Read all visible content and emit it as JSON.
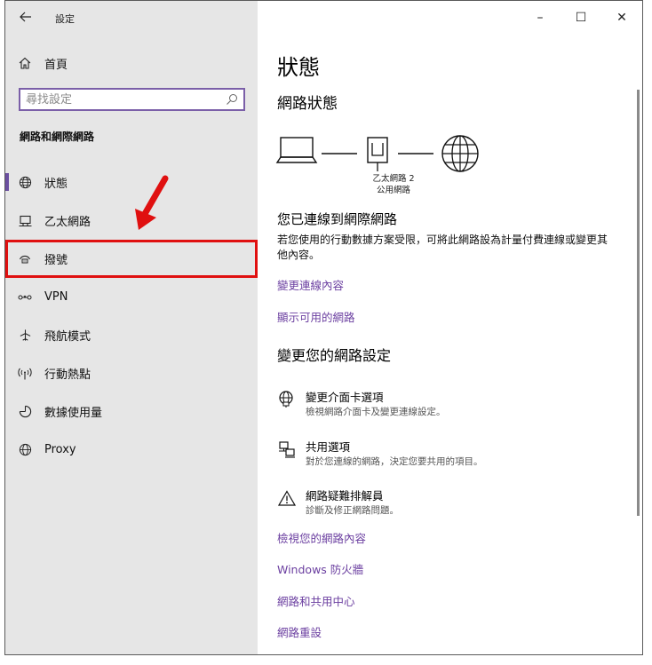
{
  "window": {
    "title": "設定",
    "minimize": "–",
    "maximize": "☐",
    "close": "✕"
  },
  "sidebar": {
    "home_label": "首頁",
    "search_placeholder": "尋找設定",
    "section_title": "網路和網際網路",
    "items": [
      {
        "label": "狀態",
        "icon": "globe-icon"
      },
      {
        "label": "乙太網路",
        "icon": "ethernet-icon"
      },
      {
        "label": "撥號",
        "icon": "dialup-icon"
      },
      {
        "label": "VPN",
        "icon": "vpn-icon"
      },
      {
        "label": "飛航模式",
        "icon": "airplane-icon"
      },
      {
        "label": "行動熱點",
        "icon": "hotspot-icon"
      },
      {
        "label": "數據使用量",
        "icon": "data-usage-icon"
      },
      {
        "label": "Proxy",
        "icon": "globe-icon"
      }
    ],
    "selected_index": 0,
    "highlighted_index": 2
  },
  "main": {
    "title": "狀態",
    "network_status_heading": "網路狀態",
    "network_name": "乙太網路 2",
    "network_type": "公用網路",
    "connected_title": "您已連線到網際網路",
    "connected_desc": "若您使用的行動數據方案受限，可將此網路設為計量付費連線或變更其他內容。",
    "link_change_props": "變更連線內容",
    "link_show_networks": "顯示可用的網路",
    "change_settings_heading": "變更您的網路設定",
    "settings": [
      {
        "title": "變更介面卡選項",
        "desc": "檢視網路介面卡及變更連線設定。",
        "icon": "adapter-icon"
      },
      {
        "title": "共用選項",
        "desc": "對於您連線的網路，決定您要共用的項目。",
        "icon": "sharing-icon"
      },
      {
        "title": "網路疑難排解員",
        "desc": "診斷及修正網路問題。",
        "icon": "warning-icon"
      }
    ],
    "link_view_props": "檢視您的網路內容",
    "link_firewall": "Windows 防火牆",
    "link_sharing_center": "網路和共用中心",
    "link_reset": "網路重設"
  },
  "colors": {
    "accent": "#6b3fa0",
    "highlight_box": "#e01010",
    "sidebar_bg": "#e6e6e6"
  }
}
